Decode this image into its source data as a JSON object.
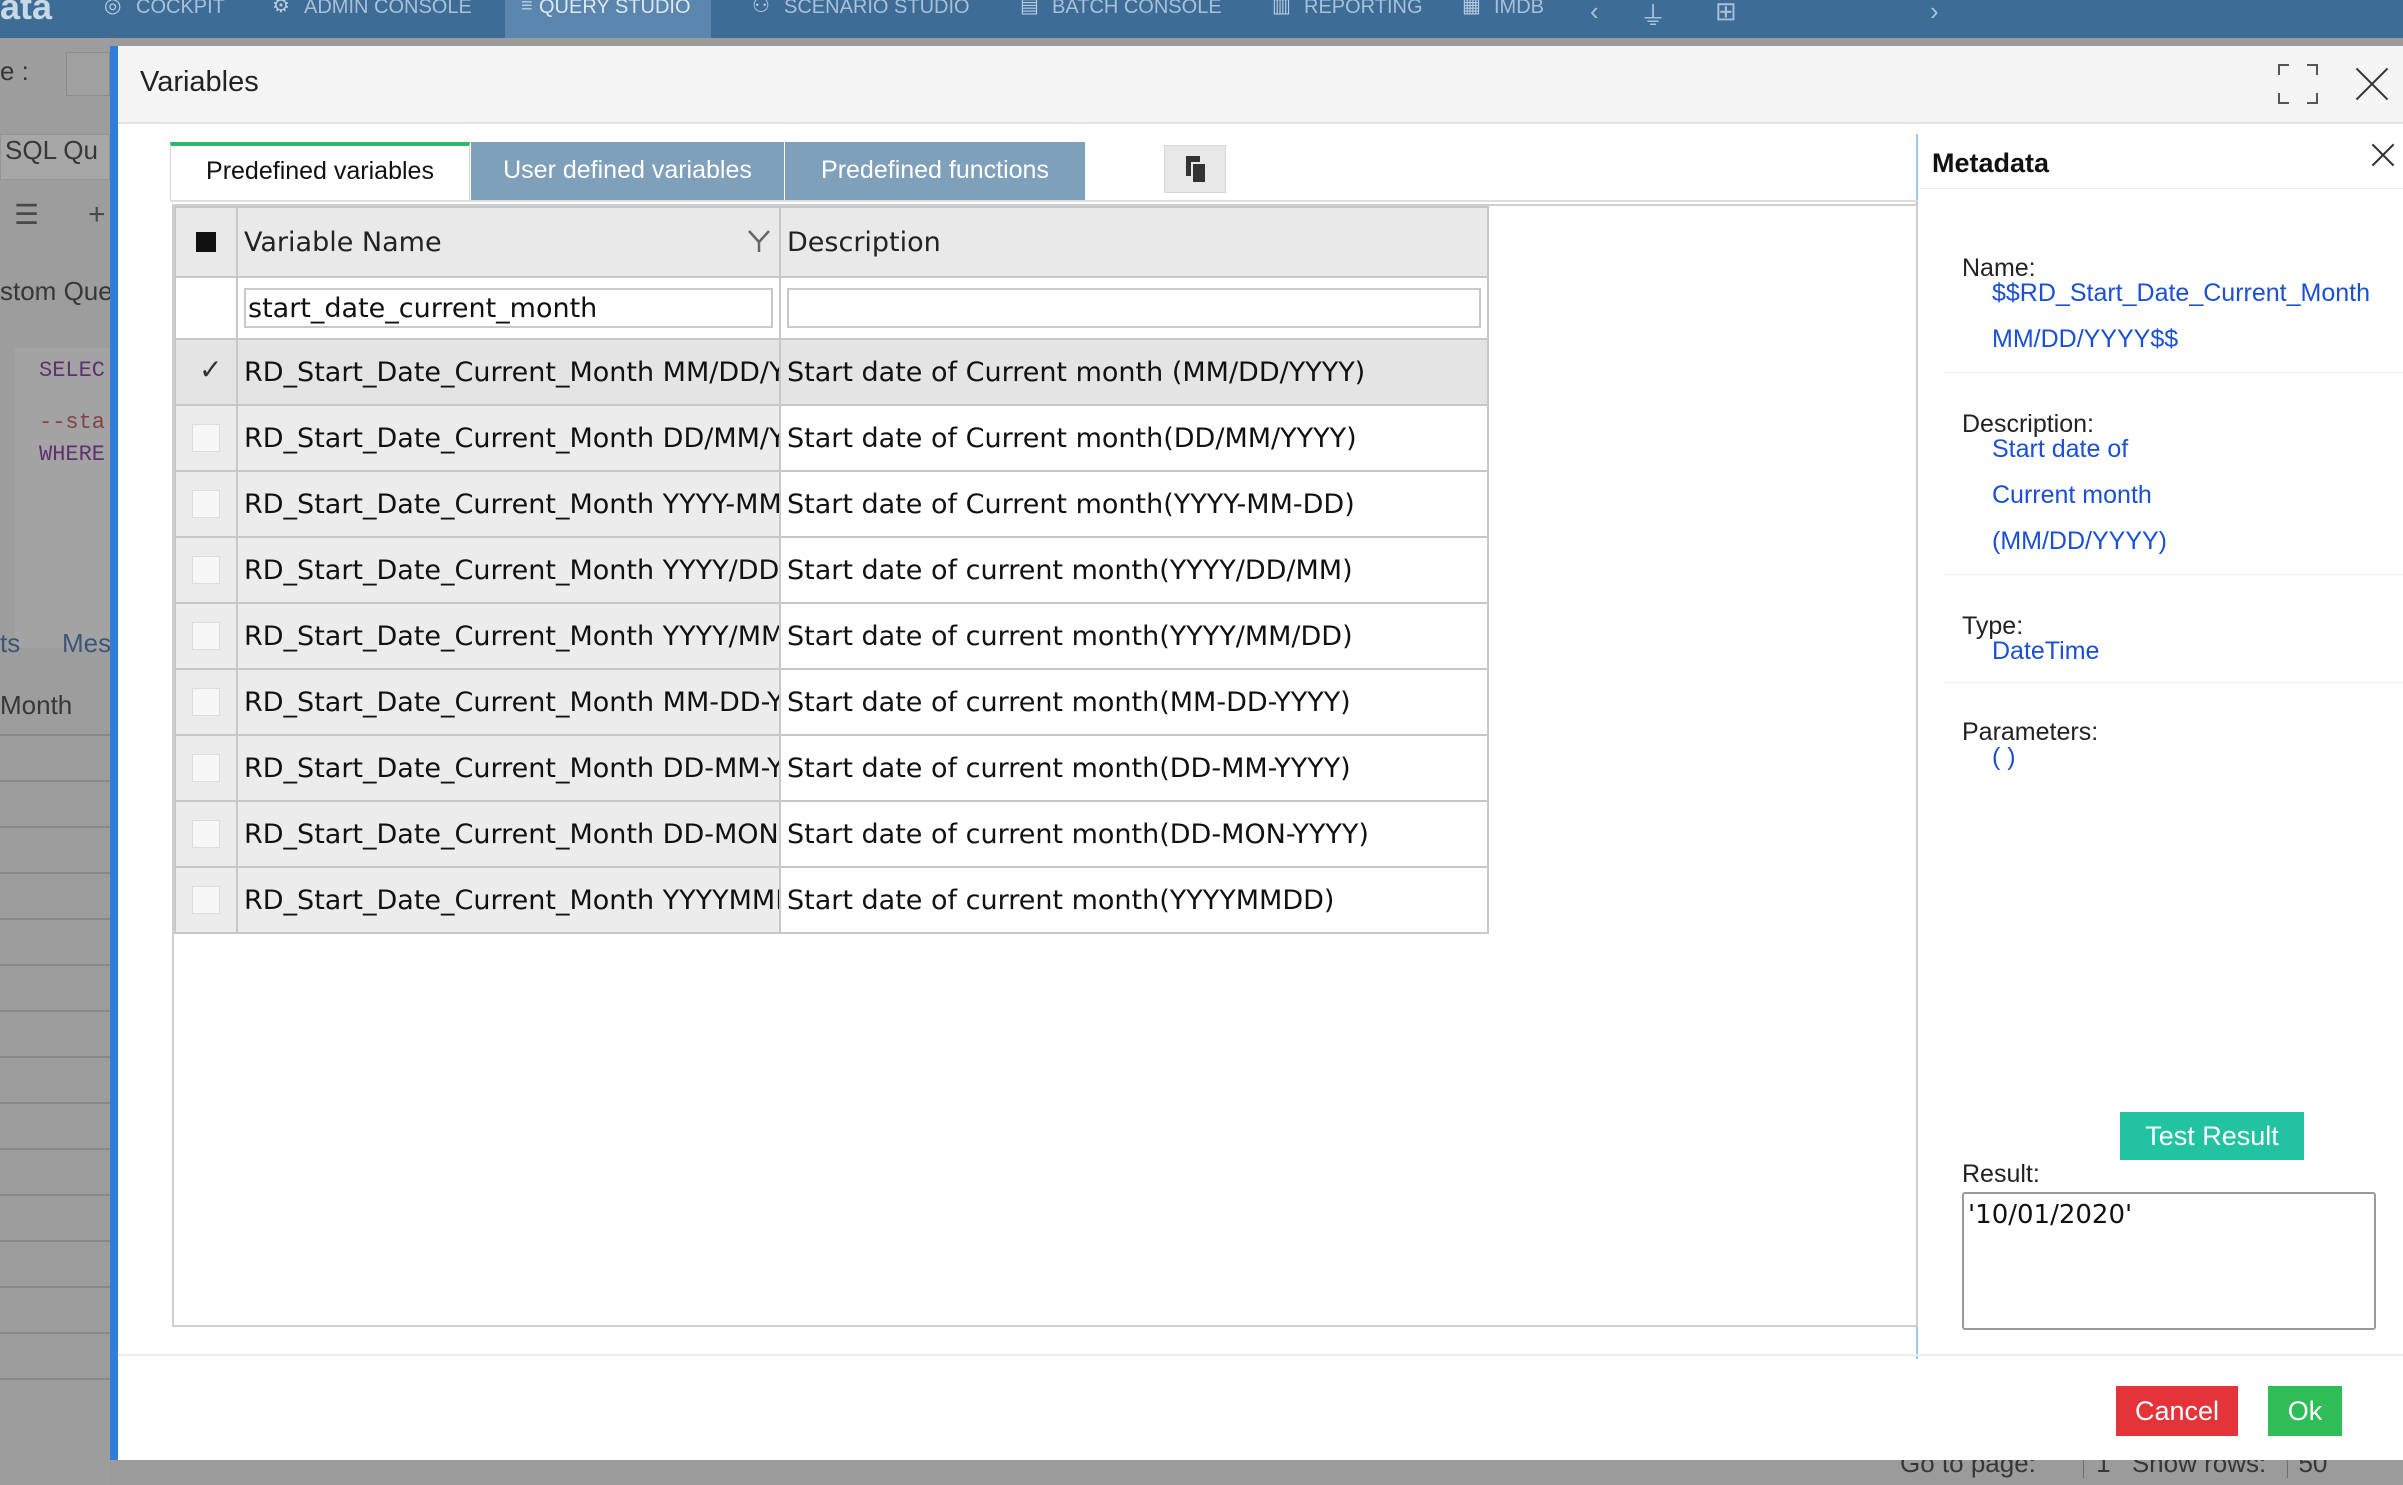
{
  "app": {
    "brand": "ata",
    "nav": [
      {
        "label": "COCKPIT",
        "icon": "cockpit-icon"
      },
      {
        "label": "ADMIN CONSOLE",
        "icon": "gear-icon"
      },
      {
        "label": "QUERY STUDIO",
        "icon": "database-icon"
      },
      {
        "label": "SCENARIO STUDIO",
        "icon": "scenario-icon"
      },
      {
        "label": "BATCH CONSOLE",
        "icon": "batch-icon"
      },
      {
        "label": "REPORTING",
        "icon": "bar-chart-icon"
      },
      {
        "label": "IMDB",
        "icon": "imdb-icon"
      }
    ],
    "background": {
      "label_e": "e :",
      "sql_tab": "SQL Qu",
      "custom_query": "stom Que",
      "code_line1": "SELEC",
      "code_line2": "--sta",
      "code_line3": "WHERE",
      "tab_ts": "ts",
      "tab_mes": "Mes",
      "col_month": "Month",
      "go_to_page_label": "Go to page:",
      "go_to_page_value": "1",
      "show_rows_label": "Show rows:",
      "show_rows_value": "50"
    }
  },
  "dialog": {
    "title": "Variables",
    "tabs": [
      {
        "label": "Predefined variables",
        "active": true
      },
      {
        "label": "User defined variables",
        "active": false
      },
      {
        "label": "Predefined functions",
        "active": false
      }
    ],
    "grid": {
      "columns": {
        "name": "Variable Name",
        "description": "Description"
      },
      "filter": {
        "name_value": "start_date_current_month",
        "description_value": ""
      },
      "rows": [
        {
          "name": "RD_Start_Date_Current_Month MM/DD/YYYY",
          "description": "Start date of Current month (MM/DD/YYYY)",
          "checked": true
        },
        {
          "name": "RD_Start_Date_Current_Month DD/MM/YYYY",
          "description": "Start date of Current month(DD/MM/YYYY)",
          "checked": false
        },
        {
          "name": "RD_Start_Date_Current_Month YYYY-MM-DD",
          "description": "Start date of Current month(YYYY-MM-DD)",
          "checked": false
        },
        {
          "name": "RD_Start_Date_Current_Month YYYY/DD/MM",
          "description": "Start date of current month(YYYY/DD/MM)",
          "checked": false
        },
        {
          "name": "RD_Start_Date_Current_Month YYYY/MM/DD",
          "description": "Start date of current month(YYYY/MM/DD)",
          "checked": false
        },
        {
          "name": "RD_Start_Date_Current_Month MM-DD-YYYY",
          "description": "Start date of current month(MM-DD-YYYY)",
          "checked": false
        },
        {
          "name": "RD_Start_Date_Current_Month DD-MM-YYYY",
          "description": "Start date of current month(DD-MM-YYYY)",
          "checked": false
        },
        {
          "name": "RD_Start_Date_Current_Month DD-MON-YYYY",
          "description": "Start date of current month(DD-MON-YYYY)",
          "checked": false
        },
        {
          "name": "RD_Start_Date_Current_Month YYYYMMDD",
          "description": "Start date of current month(YYYYMMDD)",
          "checked": false
        }
      ]
    },
    "metadata": {
      "title": "Metadata",
      "name_label": "Name:",
      "name_value": "$$RD_Start_Date_Current_Month\nMM/DD/YYYY$$",
      "description_label": "Description:",
      "description_value": "Start date of\nCurrent month\n(MM/DD/YYYY)",
      "type_label": "Type:",
      "type_value": "DateTime",
      "parameters_label": "Parameters:",
      "parameters_value": "( )",
      "test_button": "Test Result",
      "result_label": "Result:",
      "result_value": "'10/01/2020'"
    },
    "footer": {
      "cancel": "Cancel",
      "ok": "Ok"
    }
  },
  "colors": {
    "nav_bar": "#3d6c97",
    "active_tab_accent": "#2fb86a",
    "inactive_tab": "#7ea0bb",
    "link_blue": "#1a4fd6",
    "test_button": "#22c3a2",
    "cancel_button": "#e5333a",
    "ok_button": "#2ebd57"
  }
}
